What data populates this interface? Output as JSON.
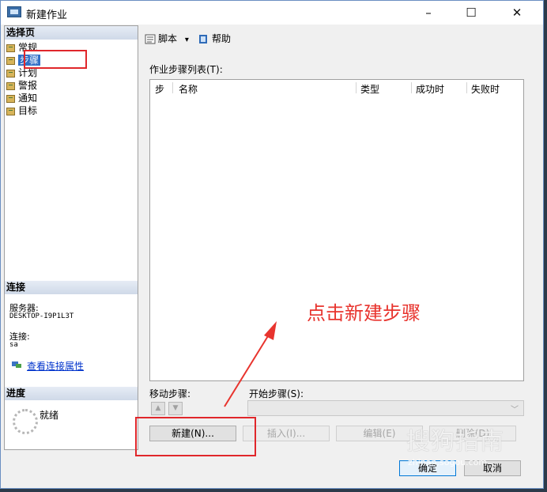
{
  "window": {
    "title": "新建作业",
    "minimize": "–",
    "maximize": "☐",
    "close": "✕"
  },
  "left_panel": {
    "select_page_header": "选择页",
    "pages": [
      {
        "label": "常规"
      },
      {
        "label": "步骤"
      },
      {
        "label": "计划"
      },
      {
        "label": "警报"
      },
      {
        "label": "通知"
      },
      {
        "label": "目标"
      }
    ],
    "selected_page": "步骤",
    "connection_header": "连接",
    "server_label": "服务器:",
    "server_value": "DESKTOP-I9P1L3T",
    "connection_label": "连接:",
    "connection_value": "sa",
    "view_connection_link": "查看连接属性",
    "progress_header": "进度",
    "progress_status": "就绪"
  },
  "toolbar": {
    "script_label": "脚本",
    "script_dropdown": "▾",
    "help_label": "帮助"
  },
  "steps": {
    "list_label": "作业步骤列表(T):",
    "columns": [
      "步",
      "名称",
      "类型",
      "成功时",
      "失败时"
    ],
    "rows": [],
    "move_label": "移动步骤:",
    "move_up": "▲",
    "move_down": "▼",
    "start_label": "开始步骤(S):",
    "start_value": "",
    "start_chevron": "﹀",
    "new_button": "新建(N)...",
    "insert_button": "插入(I)...",
    "edit_button": "编辑(E)",
    "delete_button": "删除(D)"
  },
  "dialog_buttons": {
    "ok": "确定",
    "cancel": "取消"
  },
  "annotation": {
    "text": "点击新建步骤",
    "color": "#e8342e"
  },
  "watermark": {
    "text": "搜狗指南",
    "sub": "zhinan.sogou.com"
  }
}
